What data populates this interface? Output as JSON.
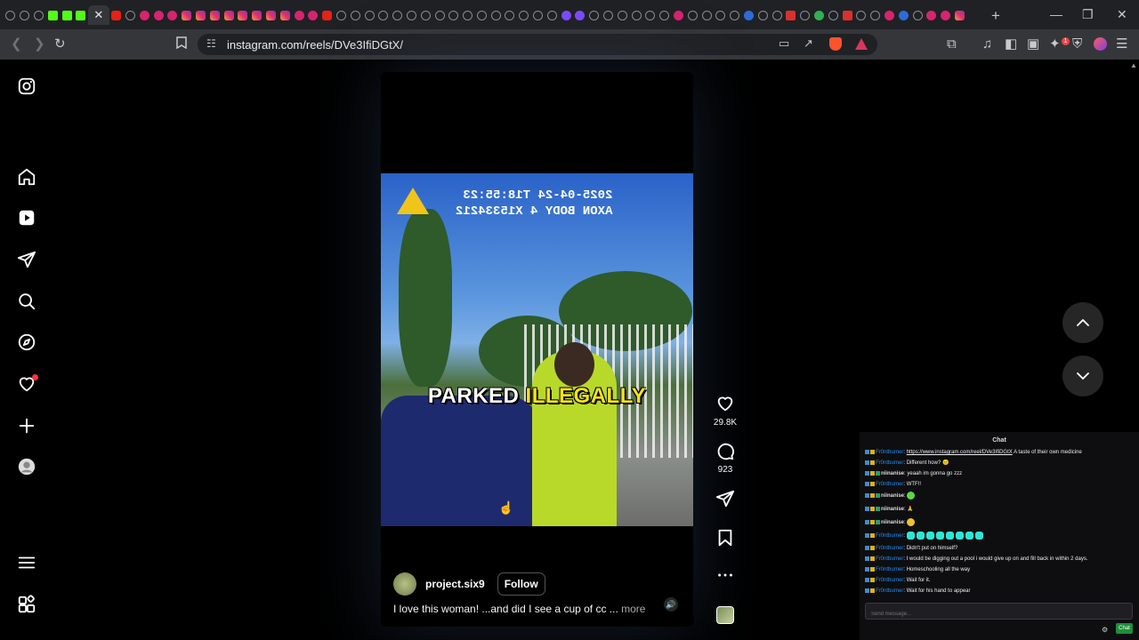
{
  "browser": {
    "url": "instagram.com/reels/DVe3IfiDGtX/",
    "active_tab_close": "✕",
    "new_tab": "+",
    "min": "—",
    "max": "❐",
    "close": "✕",
    "extension_badge": "1",
    "tab_icons": [
      "circle",
      "circle",
      "circle",
      "kick",
      "kick",
      "kick",
      "active",
      "yt",
      "circle",
      "pk",
      "pk",
      "pk",
      "ig",
      "ig",
      "ig",
      "ig",
      "ig",
      "ig",
      "ig",
      "ig",
      "pk",
      "pk",
      "yt",
      "circle",
      "circle",
      "circle",
      "circle",
      "circle",
      "circle",
      "circle",
      "circle",
      "circle",
      "circle",
      "circle",
      "circle",
      "circle",
      "circle",
      "circle",
      "circle",
      "pu",
      "pu",
      "circle",
      "circle",
      "circle",
      "circle",
      "circle",
      "circle",
      "pk",
      "circle",
      "circle",
      "circle",
      "circle",
      "bl",
      "circle",
      "circle",
      "rd",
      "circle",
      "gr",
      "circle",
      "rd",
      "circle",
      "circle",
      "pk",
      "bl",
      "circle",
      "pk",
      "pk",
      "ig"
    ]
  },
  "reel": {
    "timestamp_line1": "2025-04-24 T18:55:23",
    "timestamp_line2": "AXON BODY 4 X15334212",
    "overlay_white": "PARKED ",
    "overlay_yellow": "ILLEGALLY",
    "username": "project.six9",
    "follow_label": "Follow",
    "description": "I love this woman! ...and did I see a cup of cc ...",
    "more_label": " more",
    "likes": "29.8K",
    "comments": "923"
  },
  "icons": {
    "instagram": "instagram-logo-icon",
    "home": "home-icon",
    "reels": "reels-icon",
    "messages": "send-icon",
    "search": "search-icon",
    "explore": "compass-icon",
    "notifications": "heart-icon",
    "create": "plus-icon",
    "profile": "profile-avatar-icon",
    "more": "hamburger-menu-icon",
    "also_from_meta": "apps-grid-icon"
  },
  "chat": {
    "title": "Chat",
    "input_placeholder": "Send message...",
    "send_label": "Chat",
    "messages": [
      {
        "user": "Fr0ntburner",
        "text": "https://www.instagram.com/reel/DVe3IfiDGtX",
        "after": " A taste of their own medicine",
        "link": true
      },
      {
        "user": "Fr0ntburner",
        "text": "Different how? 😐"
      },
      {
        "user": "niinanise",
        "text": "yeaah im gonna go zzz",
        "alt": true
      },
      {
        "user": "Fr0ntburner",
        "text": "WTF!!"
      },
      {
        "user": "niinanise",
        "text": "",
        "emotes": [
          "g"
        ],
        "alt": true,
        "tall": true
      },
      {
        "user": "niinanise",
        "text": "🙏",
        "alt": true,
        "tall": true
      },
      {
        "user": "niinanise",
        "text": "",
        "emotes": [
          "y"
        ],
        "alt": true,
        "tall": true
      },
      {
        "user": "Fr0ntburner",
        "text": "",
        "emotes": [
          "c",
          "c",
          "c",
          "c",
          "c",
          "c",
          "c",
          "c"
        ],
        "tall": true
      },
      {
        "user": "Fr0ntburner",
        "text": "Didn't put on himself?"
      },
      {
        "user": "Fr0ntburner",
        "text": "I would be digging out a pool i would give up on and fill back in within 2 days."
      },
      {
        "user": "Fr0ntburner",
        "text": "Homeschooling all the way"
      },
      {
        "user": "Fr0ntburner",
        "text": "Wait for it."
      },
      {
        "user": "Fr0ntburner",
        "text": "Wait for his hand to appear"
      }
    ]
  }
}
